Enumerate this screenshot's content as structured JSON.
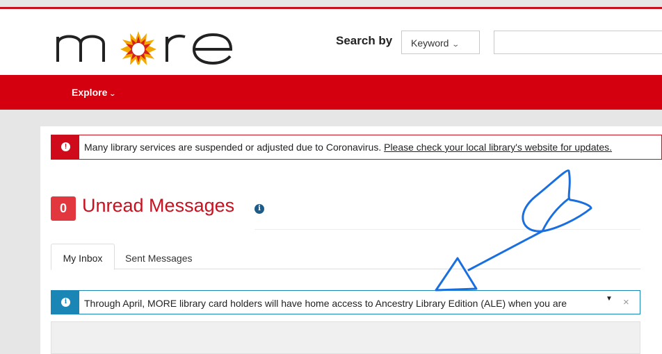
{
  "header": {
    "logo_text": "more",
    "search_label": "Search by",
    "search_type": "Keyword",
    "search_value": ""
  },
  "nav": {
    "explore_label": "Explore"
  },
  "alert": {
    "text": "Many library services are suspended or adjusted due to Coronavirus.",
    "link": "Please check your local library's website for updates."
  },
  "messages": {
    "count": "0",
    "title": "Unread Messages"
  },
  "tabs": [
    {
      "label": "My Inbox",
      "active": true
    },
    {
      "label": "Sent Messages",
      "active": false
    }
  ],
  "notice": {
    "text": "Through April, MORE library card holders will have home access to Ancestry Library Edition (ALE) when you are"
  },
  "colors": {
    "brand_red": "#d4000f",
    "info_blue": "#1a86b5",
    "annotation_blue": "#1a6fe0"
  }
}
